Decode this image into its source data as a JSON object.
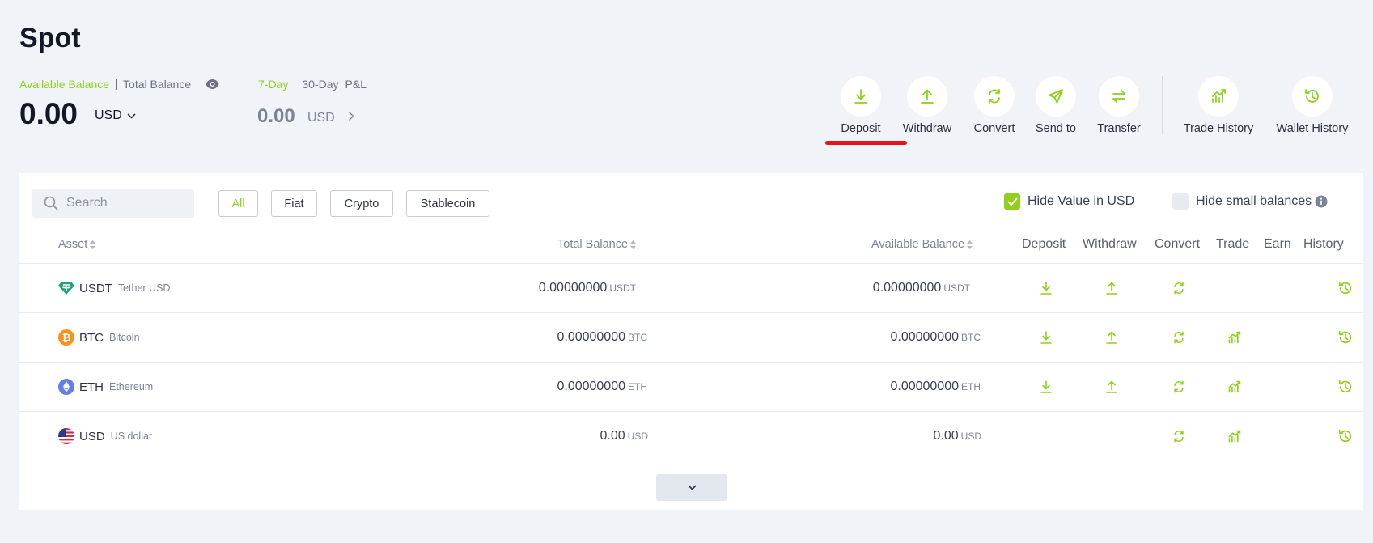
{
  "page": {
    "title": "Spot"
  },
  "balance": {
    "tab_available": "Available Balance",
    "tab_total": "Total Balance",
    "value": "0.00",
    "currency": "USD"
  },
  "pnl": {
    "tab_7day": "7-Day",
    "tab_30day": "30-Day",
    "label": "P&L",
    "value": "0.00",
    "currency": "USD"
  },
  "actions": [
    {
      "label": "Deposit",
      "icon": "download-icon"
    },
    {
      "label": "Withdraw",
      "icon": "upload-icon"
    },
    {
      "label": "Convert",
      "icon": "convert-icon"
    },
    {
      "label": "Send to",
      "icon": "send-icon"
    },
    {
      "label": "Transfer",
      "icon": "transfer-icon"
    },
    {
      "label": "Trade History",
      "icon": "trade-chart-icon"
    },
    {
      "label": "Wallet History",
      "icon": "history-icon"
    }
  ],
  "toolbar": {
    "search_placeholder": "Search",
    "filters": [
      "All",
      "Fiat",
      "Crypto",
      "Stablecoin"
    ],
    "hide_value_label": "Hide Value in USD",
    "hide_small_label": "Hide small balances"
  },
  "table": {
    "headers": {
      "asset": "Asset",
      "total": "Total Balance",
      "available": "Available Balance",
      "deposit": "Deposit",
      "withdraw": "Withdraw",
      "convert": "Convert",
      "trade": "Trade",
      "earn": "Earn",
      "history": "History"
    },
    "rows": [
      {
        "symbol": "USDT",
        "name": "Tether USD",
        "total": "0.00000000",
        "total_unit": "USDT",
        "available": "0.00000000",
        "available_unit": "USDT"
      },
      {
        "symbol": "BTC",
        "name": "Bitcoin",
        "total": "0.00000000",
        "total_unit": "BTC",
        "available": "0.00000000",
        "available_unit": "BTC"
      },
      {
        "symbol": "ETH",
        "name": "Ethereum",
        "total": "0.00000000",
        "total_unit": "ETH",
        "available": "0.00000000",
        "available_unit": "ETH"
      },
      {
        "symbol": "USD",
        "name": "US dollar",
        "total": "0.00",
        "total_unit": "USD",
        "available": "0.00",
        "available_unit": "USD"
      }
    ]
  },
  "colors": {
    "accent": "#8fd11a",
    "underline": "#e3141b",
    "usdt": "#26a17b",
    "btc": "#f7931a",
    "eth": "#627eea"
  }
}
